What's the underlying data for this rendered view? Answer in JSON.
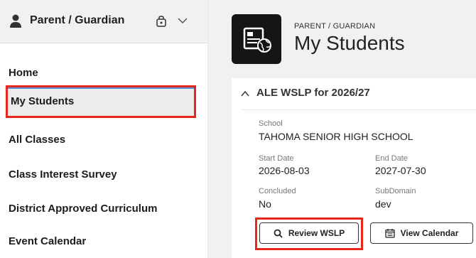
{
  "sidebar": {
    "role_label": "Parent / Guardian",
    "nav_items": [
      {
        "label": "Home"
      },
      {
        "label": "My Students"
      },
      {
        "label": "All Classes"
      },
      {
        "label": "Class Interest Survey"
      },
      {
        "label": "District Approved Curriculum"
      },
      {
        "label": "Event Calendar"
      }
    ]
  },
  "header": {
    "subtitle": "PARENT / GUARDIAN",
    "title": "My Students"
  },
  "card": {
    "title": "ALE WSLP for 2026/27",
    "school_label": "School",
    "school_value": "TAHOMA SENIOR HIGH SCHOOL",
    "start_label": "Start Date",
    "start_value": "2026-08-03",
    "end_label": "End Date",
    "end_value": "2027-07-30",
    "concluded_label": "Concluded",
    "concluded_value": "No",
    "subdomain_label": "SubDomain",
    "subdomain_value": "dev",
    "review_button": "Review WSLP",
    "calendar_button": "View Calendar"
  },
  "colors": {
    "highlight": "#e8271c",
    "header_icon_bg": "#151515"
  },
  "icons": {
    "role": "person-icon",
    "role_switch": "school-bag-icon",
    "role_expand": "chevron-down-icon",
    "header": "student-id-globe-icon",
    "card_toggle": "chevron-up-icon",
    "review": "search-icon",
    "calendar": "calendar-icon"
  }
}
